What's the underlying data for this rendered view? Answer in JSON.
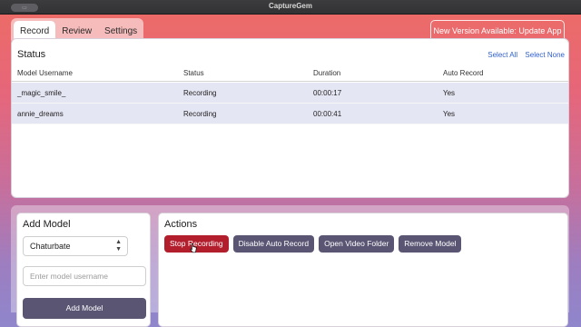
{
  "window": {
    "title": "CaptureGem",
    "titlebar_icon": "sidebar-icon"
  },
  "tabs": [
    {
      "label": "Record",
      "active": true
    },
    {
      "label": "Review",
      "active": false
    },
    {
      "label": "Settings",
      "active": false
    }
  ],
  "update_button": "New Version Available: Update App",
  "status": {
    "title": "Status",
    "select_all": "Select All",
    "select_none": "Select None",
    "columns": [
      "Model Username",
      "Status",
      "Duration",
      "Auto Record"
    ],
    "rows": [
      [
        "_magic_smile_",
        "Recording",
        "00:00:17",
        "Yes"
      ],
      [
        "annie_dreams",
        "Recording",
        "00:00:41",
        "Yes"
      ]
    ]
  },
  "add_model": {
    "title": "Add Model",
    "platform": "Chaturbate",
    "username_placeholder": "Enter model username",
    "button": "Add Model"
  },
  "actions": {
    "title": "Actions",
    "buttons": [
      "Stop Recording",
      "Disable Auto Record",
      "Open Video Folder",
      "Remove Model"
    ]
  },
  "colors": {
    "stop_button": "#b31e2d",
    "action_button": "#5b5574",
    "link": "#2f5fcc",
    "selected_row": "#e5e6f3"
  }
}
